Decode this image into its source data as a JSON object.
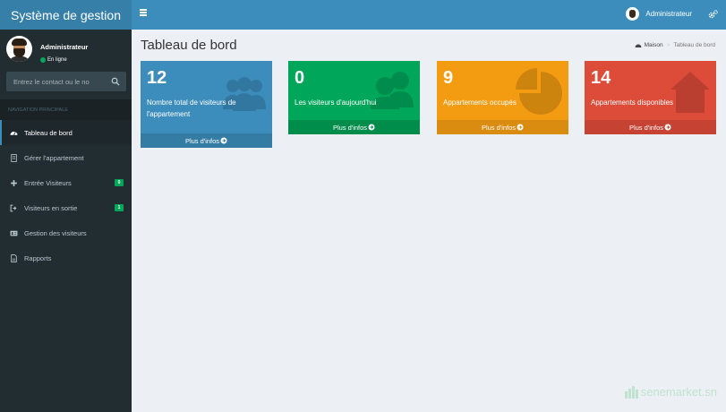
{
  "header": {
    "app_title": "Système de gestion",
    "user_name": "Administrateur"
  },
  "sidebar": {
    "user_name": "Administrateur",
    "status": "En ligne",
    "search_placeholder": "Entrez le contact ou le no",
    "nav_header": "NAVIGATION PRINCIPALE",
    "items": [
      {
        "label": "Tableau de bord",
        "icon": "dashboard-icon",
        "active": true
      },
      {
        "label": "Gérer l'appartement",
        "icon": "building-icon"
      },
      {
        "label": "Entrée Visiteurs",
        "icon": "plus-icon",
        "badge": "0"
      },
      {
        "label": "Visiteurs en sortie",
        "icon": "sign-out-icon",
        "badge": "1"
      },
      {
        "label": "Gestion des visiteurs",
        "icon": "id-card-icon"
      },
      {
        "label": "Rapports",
        "icon": "file-icon"
      }
    ]
  },
  "content": {
    "page_title": "Tableau de bord",
    "breadcrumb": {
      "home": "Maison",
      "current": "Tableau de bord"
    },
    "boxes": [
      {
        "value": "12",
        "label": "Nombre total de visiteurs de l'appartement",
        "link": "Plus d'infos",
        "color": "#3c8dbc",
        "icon": "users-icon"
      },
      {
        "value": "0",
        "label": "Les visiteurs d'aujourd'hui",
        "link": "Plus d'infos",
        "color": "#00a65a",
        "icon": "user-group-icon"
      },
      {
        "value": "9",
        "label": "Appartements occupés",
        "link": "Plus d'infos",
        "color": "#f39c12",
        "icon": "pie-chart-icon"
      },
      {
        "value": "14",
        "label": "Appartements disponibles",
        "link": "Plus d'infos",
        "color": "#dd4b39",
        "icon": "home-icon"
      }
    ]
  },
  "watermark": "senemarket.sn"
}
